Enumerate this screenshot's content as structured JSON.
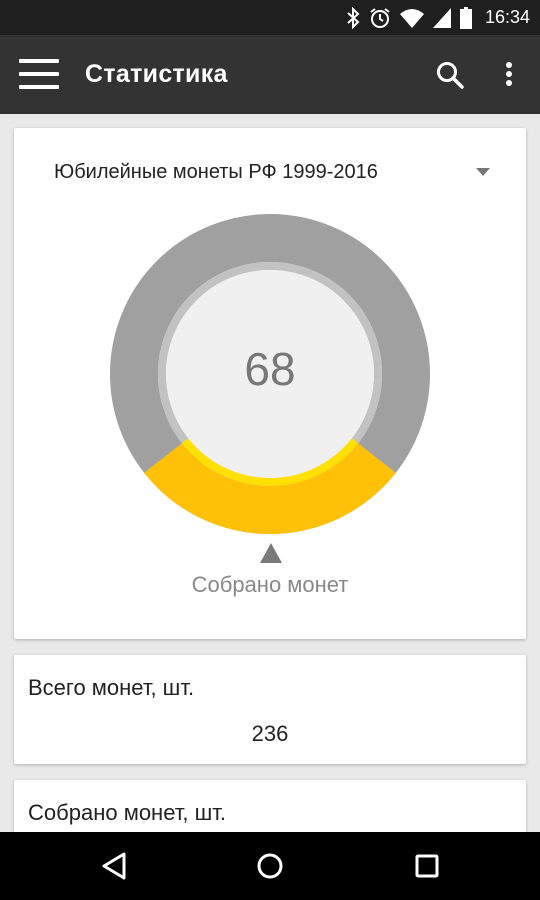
{
  "status_bar": {
    "time": "16:34",
    "icons": [
      "bluetooth-icon",
      "alarm-icon",
      "wifi-icon",
      "signal-icon",
      "battery-icon"
    ]
  },
  "app_bar": {
    "title": "Статистика",
    "icons": [
      "menu-icon",
      "search-icon",
      "more-vert-icon"
    ]
  },
  "selector": {
    "selected": "Юбилейные монеты РФ 1999-2016"
  },
  "gauge": {
    "value": "68",
    "label": "Собрано монет",
    "fill_fraction": 0.288,
    "colors": {
      "track": "#a0a0a0",
      "fill": "#ffc107",
      "inner_ring": "#c2c2c2",
      "center": "#f0f0f0"
    }
  },
  "stats": [
    {
      "title": "Всего монет, шт.",
      "value": "236"
    },
    {
      "title": "Собрано монет, шт.",
      "value": ""
    }
  ],
  "nav_bar": {
    "icons": [
      "back-icon",
      "home-icon",
      "recents-icon"
    ]
  }
}
